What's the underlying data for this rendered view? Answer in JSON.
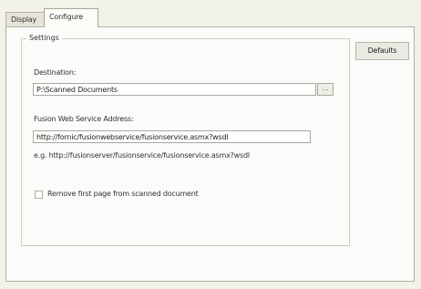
{
  "tabs": {
    "display_label": "Display",
    "configure_label": "Configure"
  },
  "settings": {
    "group_label": "Settings",
    "destination_label": "Destination:",
    "destination_value": "P:\\Scanned Documents",
    "browse_label": "...",
    "fusion_label": "Fusion Web Service Address:",
    "fusion_value": "http://fornic/fusionwebservice/fusionservice.asmx?wsdl",
    "example_text": "e.g. http://fusionserver/fusionservice/fusionservice.asmx?wsdl",
    "remove_first_page_label": "Remove first page from scanned document",
    "remove_first_page_checked": false
  },
  "actions": {
    "defaults_label": "Defaults"
  }
}
